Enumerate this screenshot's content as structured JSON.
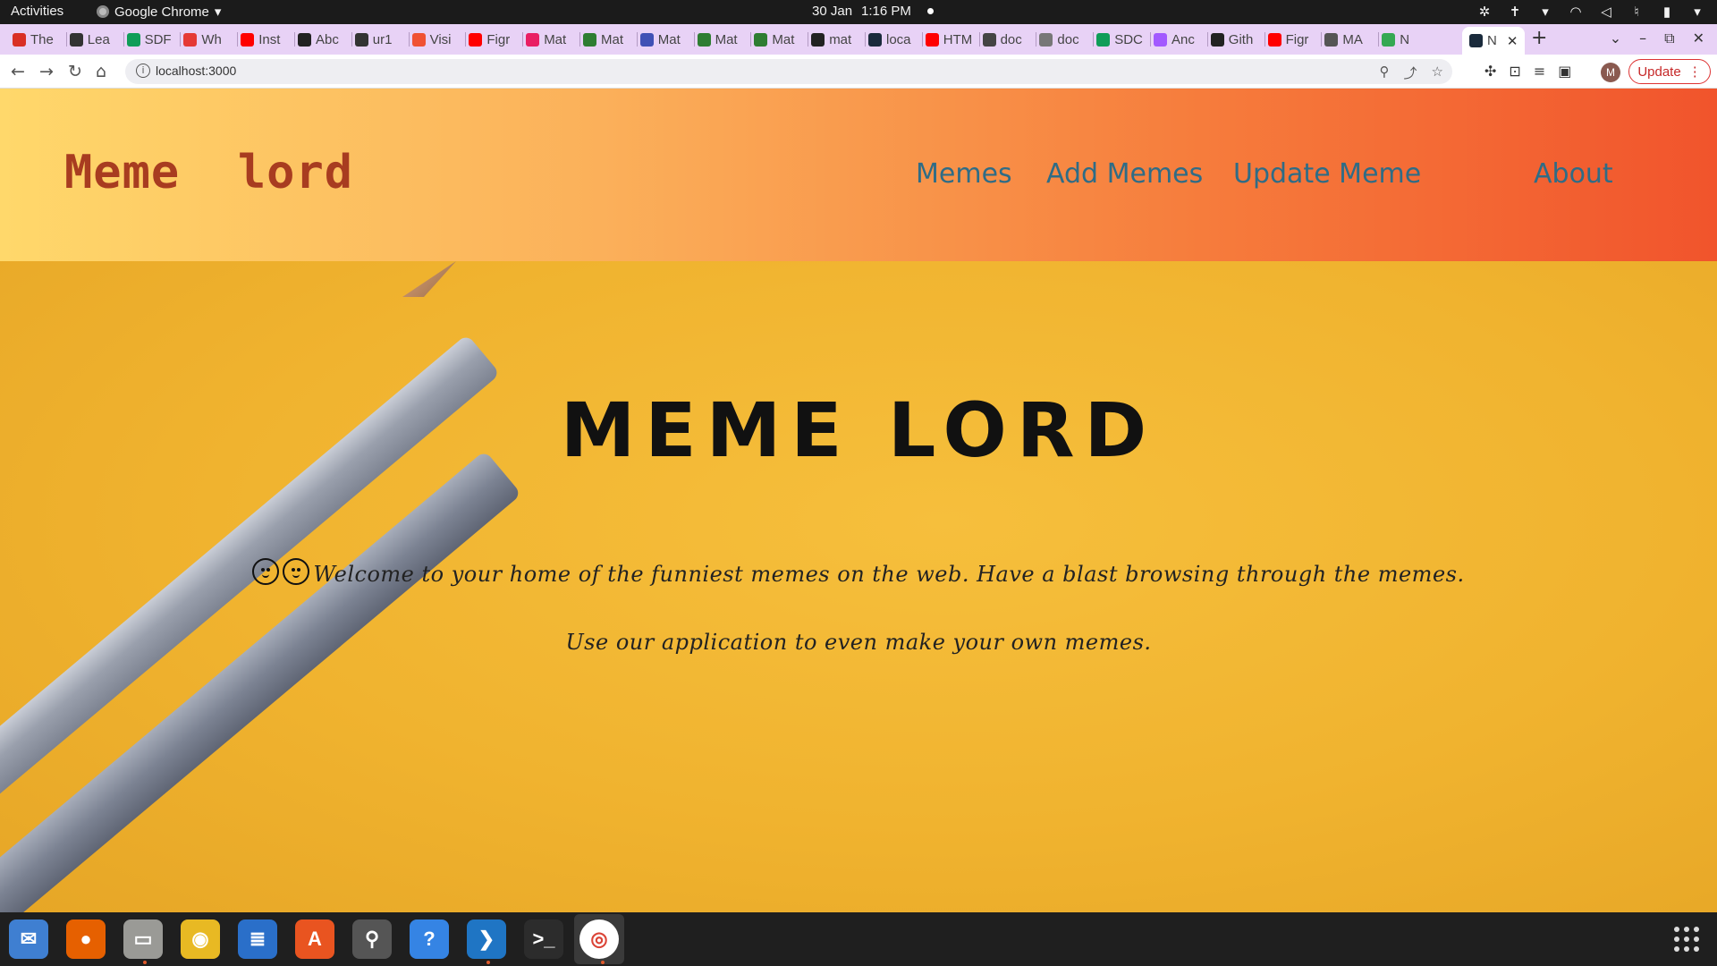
{
  "system_bar": {
    "activities": "Activities",
    "app_name": "Google Chrome",
    "date": "30 Jan",
    "time": "1:16 PM"
  },
  "browser": {
    "tabs": [
      {
        "label": "The",
        "favicon": "gmail-icon",
        "color": "#d93025"
      },
      {
        "label": "Lea",
        "favicon": "x-circle-icon",
        "color": "#333333"
      },
      {
        "label": "SDF",
        "favicon": "sheets-icon",
        "color": "#0f9d58"
      },
      {
        "label": "Wh",
        "favicon": "dots-icon",
        "color": "#e53935"
      },
      {
        "label": "Inst",
        "favicon": "youtube-icon",
        "color": "#ff0000"
      },
      {
        "label": "Abc",
        "favicon": "github-icon",
        "color": "#222222"
      },
      {
        "label": "ur1",
        "favicon": "ur-icon",
        "color": "#333333"
      },
      {
        "label": "Visi",
        "favicon": "git-icon",
        "color": "#f05133"
      },
      {
        "label": "Figr",
        "favicon": "youtube-icon",
        "color": "#ff0000"
      },
      {
        "label": "Mat",
        "favicon": "blocks-icon",
        "color": "#e91e63"
      },
      {
        "label": "Mat",
        "favicon": "code-icon",
        "color": "#2e7d32"
      },
      {
        "label": "Mat",
        "favicon": "blocks-icon",
        "color": "#3f51b5"
      },
      {
        "label": "Mat",
        "favicon": "code-icon",
        "color": "#2e7d32"
      },
      {
        "label": "Mat",
        "favicon": "code-icon",
        "color": "#2e7d32"
      },
      {
        "label": "mat",
        "favicon": "github-icon",
        "color": "#222222"
      },
      {
        "label": "loca",
        "favicon": "react-icon",
        "color": "#1a2b3c"
      },
      {
        "label": "HTM",
        "favicon": "youtube-icon",
        "color": "#ff0000"
      },
      {
        "label": "doc",
        "favicon": "table-icon",
        "color": "#444444"
      },
      {
        "label": "doc",
        "favicon": "doc-icon",
        "color": "#777777"
      },
      {
        "label": "SDC",
        "favicon": "sheets-icon",
        "color": "#0f9d58"
      },
      {
        "label": "Anc",
        "favicon": "figma-icon",
        "color": "#a259ff"
      },
      {
        "label": "Gith",
        "favicon": "github-icon",
        "color": "#222222"
      },
      {
        "label": "Figr",
        "favicon": "youtube-icon",
        "color": "#ff0000"
      },
      {
        "label": "MA",
        "favicon": "globe-icon",
        "color": "#555555"
      },
      {
        "label": "N",
        "favicon": "meet-icon",
        "color": "#34a853"
      },
      {
        "label": "N",
        "favicon": "react-icon",
        "color": "#1a2b3c",
        "active": true
      }
    ],
    "url": "localhost:3000",
    "profile_initial": "M",
    "update_label": "Update"
  },
  "site": {
    "brand": "Meme  lord",
    "nav": [
      "Memes",
      "Add Memes",
      "Update Meme",
      "About"
    ],
    "hero_title": "MEME LORD",
    "hero_line1": "Welcome to your home of the funniest memes on the web. Have a blast browsing through the memes.",
    "hero_line2": "Use our application to even make your own memes."
  },
  "dock": [
    {
      "name": "thunderbird-icon",
      "color": "#3f7fd1",
      "glyph": "✉"
    },
    {
      "name": "firefox-icon",
      "color": "#e66000",
      "glyph": "●"
    },
    {
      "name": "files-icon",
      "color": "#9a9a96",
      "glyph": "▭"
    },
    {
      "name": "rhythmbox-icon",
      "color": "#e8b923",
      "glyph": "◉"
    },
    {
      "name": "writer-icon",
      "color": "#2a6fc9",
      "glyph": "≣"
    },
    {
      "name": "app-center-icon",
      "color": "#e95420",
      "glyph": "A"
    },
    {
      "name": "usb-creator-icon",
      "color": "#555555",
      "glyph": "⚲"
    },
    {
      "name": "help-icon",
      "color": "#3584e4",
      "glyph": "?"
    },
    {
      "name": "vscode-icon",
      "color": "#1f75c4",
      "glyph": "❯"
    },
    {
      "name": "terminal-icon",
      "color": "#2c2c2c",
      "glyph": ">_"
    },
    {
      "name": "chrome-icon",
      "color": "#ffffff",
      "glyph": "◎"
    }
  ],
  "colors": {
    "brand_text": "#a83c20",
    "nav_link": "#2f6c86",
    "hero_background": "#f0b32f",
    "header_gradient_start": "#ffd86b",
    "header_gradient_end": "#f1542c"
  }
}
